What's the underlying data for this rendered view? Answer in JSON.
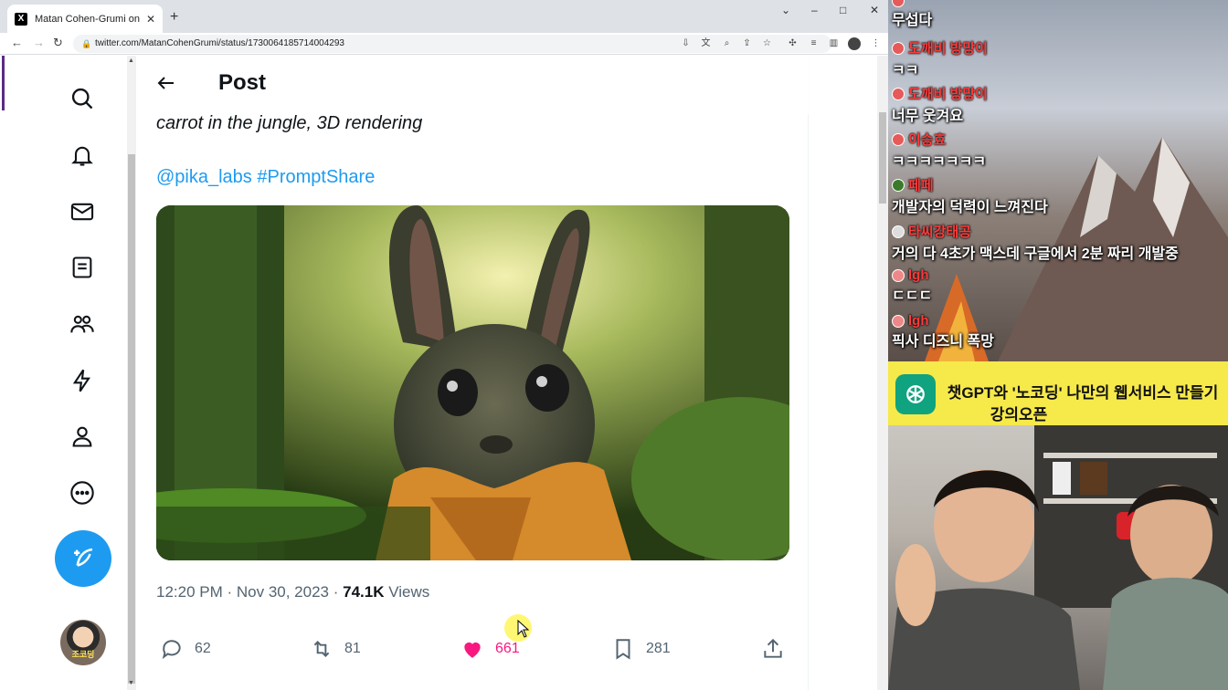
{
  "browser": {
    "tab_title": "Matan Cohen-Grumi on X: \"Sto",
    "tab_favicon": "X",
    "new_tab": "+",
    "url": "twitter.com/MatanCohenGrumi/status/1730064185714004293",
    "win_min": "–",
    "win_max": "□",
    "win_close": "✕",
    "win_dropdown": "⌄"
  },
  "post": {
    "header_title": "Post",
    "text_line": "carrot in the jungle, 3D rendering",
    "tags": "@pika_labs #PromptShare",
    "time_date": "12:20 PM · Nov 30, 2023 · ",
    "views_count": "74.1K",
    "views_label": " Views",
    "replies": "62",
    "reposts": "81",
    "likes": "661",
    "bookmarks": "281"
  },
  "sidebar": {
    "avatar_label": "조코딩"
  },
  "colors": {
    "accent": "#1d9bf0",
    "like": "#f91880",
    "text": "#0f1419",
    "muted": "#536471"
  },
  "chat": [
    {
      "user": "",
      "text": "무섭다"
    },
    {
      "user": "도깨비 방망이",
      "text": "ㅋㅋ"
    },
    {
      "user": "도깨비 방망이",
      "text": "너무 웃겨요"
    },
    {
      "user": "이승효",
      "text": "ㅋㅋㅋㅋㅋㅋㅋ"
    },
    {
      "user": "페페",
      "text": "개발자의 덕력이 느껴진다"
    },
    {
      "user": "타씨강태공",
      "text": "거의 다 4초가 맥스데 구글에서 2분 짜리 개발중"
    },
    {
      "user": "lgh",
      "text": "ㄷㄷㄷ"
    },
    {
      "user": "lgh",
      "text": "픽사 디즈니 폭망"
    }
  ],
  "banner": {
    "line1": "챗GPT와 '노코딩' 나만의 웹서비스 만들기",
    "line2": "강의오픈"
  }
}
